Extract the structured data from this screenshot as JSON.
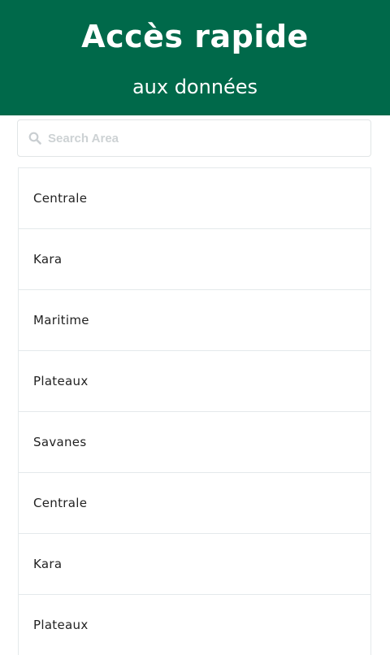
{
  "header": {
    "title": "Accès rapide",
    "subtitle": "aux données"
  },
  "search": {
    "placeholder": "Search Area",
    "value": "",
    "icon": "search-icon"
  },
  "colors": {
    "header_bg": "#00694a",
    "header_text": "#ffffff",
    "border": "#e4e9eb",
    "placeholder": "#cdd2d4"
  },
  "areas": [
    "Centrale",
    "Kara",
    "Maritime",
    "Plateaux",
    "Savanes",
    "Centrale",
    "Kara",
    "Plateaux"
  ]
}
